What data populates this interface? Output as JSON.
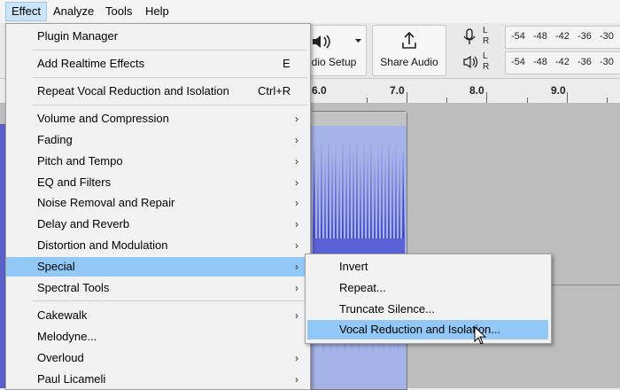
{
  "menubar": {
    "items": [
      {
        "label": "Effect",
        "active": true
      },
      {
        "label": "Analyze"
      },
      {
        "label": "Tools"
      },
      {
        "label": "Help"
      }
    ]
  },
  "toolbar": {
    "audio_setup_label": "dio Setup",
    "share_audio_label": "Share Audio",
    "meter_ticks": [
      "-54",
      "-48",
      "-42",
      "-36",
      "-30"
    ],
    "meter_channels": [
      "L",
      "R"
    ],
    "icons": [
      "speaker-icon",
      "chevron-down-icon",
      "upload-icon",
      "microphone-icon",
      "speaker-icon"
    ]
  },
  "ruler": {
    "labels": [
      "6.0",
      "7.0",
      "8.0",
      "9.0"
    ]
  },
  "effect_menu": {
    "items": [
      {
        "label": "Plugin Manager",
        "shortcut": "",
        "submenu": false
      },
      {
        "label": "Add Realtime Effects",
        "shortcut": "E",
        "submenu": false
      },
      {
        "label": "Repeat Vocal Reduction and Isolation",
        "shortcut": "Ctrl+R",
        "submenu": false
      },
      {
        "label": "Volume and Compression",
        "submenu": true
      },
      {
        "label": "Fading",
        "submenu": true
      },
      {
        "label": "Pitch and Tempo",
        "submenu": true
      },
      {
        "label": "EQ and Filters",
        "submenu": true
      },
      {
        "label": "Noise Removal and Repair",
        "submenu": true
      },
      {
        "label": "Delay and Reverb",
        "submenu": true
      },
      {
        "label": "Distortion and Modulation",
        "submenu": true
      },
      {
        "label": "Special",
        "submenu": true,
        "highlighted": true
      },
      {
        "label": "Spectral Tools",
        "submenu": true
      },
      {
        "label": "Cakewalk",
        "submenu": true
      },
      {
        "label": "Melodyne...",
        "submenu": false
      },
      {
        "label": "Overloud",
        "submenu": true
      },
      {
        "label": "Paul Licameli",
        "submenu": true
      }
    ]
  },
  "special_submenu": {
    "items": [
      {
        "label": "Invert"
      },
      {
        "label": "Repeat..."
      },
      {
        "label": "Truncate Silence..."
      },
      {
        "label": "Vocal Reduction and Isolation...",
        "highlighted": true
      }
    ]
  },
  "colors": {
    "menu_highlight": "#91c8f6",
    "waveform": "#3f45c4",
    "waveform_bg": "#a6b3e8"
  }
}
